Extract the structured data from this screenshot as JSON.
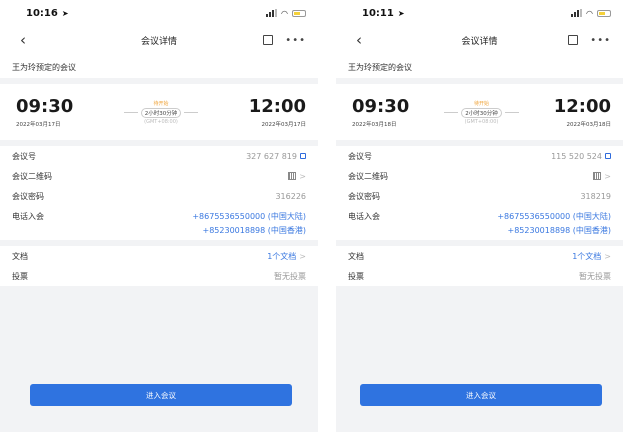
{
  "screens": [
    {
      "status_time": "10:16",
      "nav_title": "会议详情",
      "host": "王为玲预定的会议",
      "start_time": "09:30",
      "start_date": "2022年03月17日",
      "status": "待开始",
      "duration": "2小时30分钟",
      "timezone": "(GMT+08:00)",
      "end_time": "12:00",
      "end_date": "2022年03月17日",
      "rows": [
        {
          "label": "会议号",
          "value": "327 627 819"
        },
        {
          "label": "会议二维码"
        },
        {
          "label": "会议密码",
          "value": "316226"
        }
      ],
      "phone_label": "电话入会",
      "phones": [
        "+8675536550000 (中国大陆)",
        "+85230018898 (中国香港)"
      ],
      "docs_label": "文档",
      "docs_value": "1个文档",
      "vote_label": "投票",
      "vote_value": "暂无投票",
      "join_button": "进入会议"
    },
    {
      "status_time": "10:11",
      "nav_title": "会议详情",
      "host": "王为玲预定的会议",
      "start_time": "09:30",
      "start_date": "2022年03月18日",
      "status": "待开始",
      "duration": "2小时30分钟",
      "timezone": "(GMT+08:00)",
      "end_time": "12:00",
      "end_date": "2022年03月18日",
      "rows": [
        {
          "label": "会议号",
          "value": "115 520 524"
        },
        {
          "label": "会议二维码"
        },
        {
          "label": "会议密码",
          "value": "318219"
        }
      ],
      "phone_label": "电话入会",
      "phones": [
        "+8675536550000 (中国大陆)",
        "+85230018898 (中国香港)"
      ],
      "docs_label": "文档",
      "docs_value": "1个文档",
      "vote_label": "投票",
      "vote_value": "暂无投票",
      "join_button": "进入会议"
    }
  ]
}
